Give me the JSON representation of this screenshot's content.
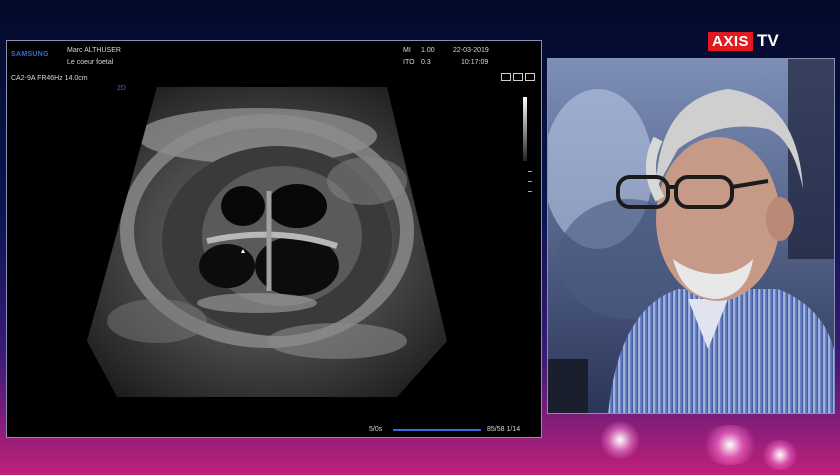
{
  "logo": {
    "axis_text": "AXIS",
    "tv_text": "TV"
  },
  "ultrasound": {
    "brand": "SAMSUNG",
    "operator": "Marc ALTHUSER",
    "exam_title": "Le coeur foetal",
    "probe_info": "CA2-9A  FR46Hz  14.0cm",
    "mi_label": "MI",
    "mi_value": "1.00",
    "date": "22-03-2019",
    "ito_label": "ITO",
    "ito_value": "0.3",
    "time": "10:17:09",
    "mode_label": "2D",
    "frame_left": "5/0s",
    "frame_right": "85/58 1/14"
  },
  "colors": {
    "accent_red": "#e11a22",
    "samsung_blue": "#3a6ad8",
    "cine_blue": "#2f6ee0"
  }
}
